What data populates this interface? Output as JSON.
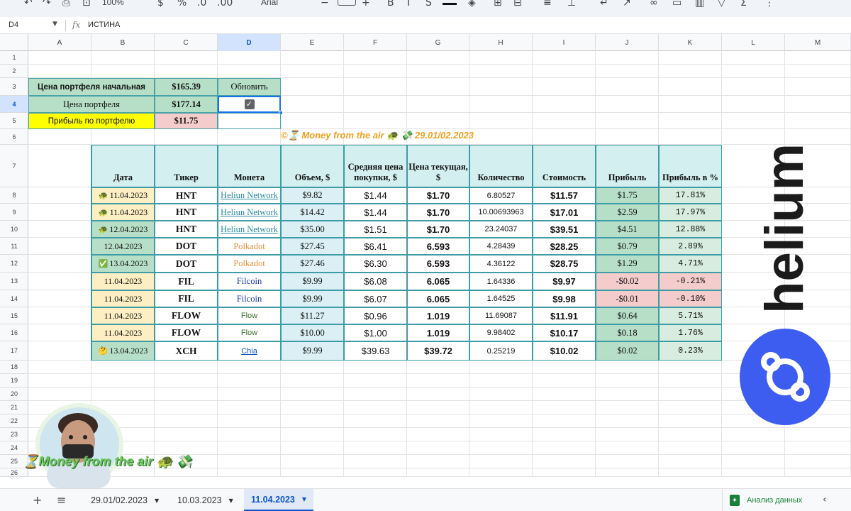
{
  "toolbar": {
    "zoom": "100%",
    "font_name": "Arial",
    "font_size": "10",
    "items": [
      "undo-icon",
      "redo-icon",
      "print-icon",
      "paint-format-icon",
      "currency-icon",
      "percent-icon",
      "decimal-decrease-icon",
      "decimal-increase-icon",
      "font-size-minus-icon",
      "font-size-plus-icon",
      "bold-icon",
      "italic-icon",
      "strikethrough-icon",
      "text-color-icon",
      "fill-color-icon",
      "borders-icon",
      "merge-icon",
      "align-icon",
      "valign-icon",
      "wrap-icon",
      "rotate-icon",
      "link-icon",
      "comment-icon",
      "chart-icon",
      "filter-icon",
      "functions-icon",
      "more-icon"
    ]
  },
  "formula_bar": {
    "cell_ref": "D4",
    "fx_label": "fx",
    "value": "ИСТИНА"
  },
  "columns": [
    "A",
    "B",
    "C",
    "D",
    "E",
    "F",
    "G",
    "H",
    "I",
    "J",
    "K",
    "L",
    "M"
  ],
  "selected_column": "D",
  "rows": [
    "1",
    "2",
    "3",
    "4",
    "5",
    "6",
    "7",
    "8",
    "9",
    "10",
    "11",
    "12",
    "13",
    "14",
    "15",
    "16",
    "17",
    "18",
    "19",
    "20",
    "21",
    "22",
    "23",
    "24",
    "25",
    "26"
  ],
  "selected_row": "4",
  "summary": {
    "start_label": "Цена портфеля начальная",
    "start_value": "$165.39",
    "refresh_label": "Обновить",
    "current_label": "Цена портфеля",
    "current_value": "$177.14",
    "checkbox_checked": true,
    "profit_label": "Прибыль по портфелю",
    "profit_value": "$11.75"
  },
  "banner": "©⏳ Money from the air 🐢 💸  29.01/02.2023",
  "table": {
    "headers": [
      "Дата",
      "Тикер",
      "Монета",
      "Объем, $",
      "Средняя цена покупки, $",
      "Цена текущая, $",
      "Количество",
      "Стоимость",
      "Прибыль",
      "Прибыль в %"
    ],
    "rows": [
      {
        "date": "11.04.2023",
        "icon": "🐢",
        "ticker": "HNT",
        "coin": "Heliun Network",
        "volume": "$9.82",
        "avg_price": "$1.44",
        "cur_price": "$1.70",
        "qty": "6.80527",
        "cost": "$11.57",
        "profit": "$1.75",
        "profit_pct": "17.81%"
      },
      {
        "date": "11.04.2023",
        "icon": "🐢",
        "ticker": "HNT",
        "coin": "Heliun Network",
        "volume": "$14.42",
        "avg_price": "$1.44",
        "cur_price": "$1.70",
        "qty": "10.00693963",
        "cost": "$17.01",
        "profit": "$2.59",
        "profit_pct": "17.97%"
      },
      {
        "date": "12.04.2023",
        "icon": "🐢",
        "ticker": "HNT",
        "coin": "Heliun Network",
        "volume": "$35.00",
        "avg_price": "$1.51",
        "cur_price": "$1.70",
        "qty": "23.24037",
        "cost": "$39.51",
        "profit": "$4.51",
        "profit_pct": "12.88%"
      },
      {
        "date": "12.04.2023",
        "icon": "",
        "ticker": "DOT",
        "coin": "Polkadot",
        "volume": "$27.45",
        "avg_price": "$6.41",
        "cur_price": "6.593",
        "qty": "4.28439",
        "cost": "$28.25",
        "profit": "$0.79",
        "profit_pct": "2.89%"
      },
      {
        "date": "13.04.2023",
        "icon": "✅",
        "ticker": "DOT",
        "coin": "Polkadot",
        "volume": "$27.46",
        "avg_price": "$6.30",
        "cur_price": "6.593",
        "qty": "4.36122",
        "cost": "$28.75",
        "profit": "$1.29",
        "profit_pct": "4.71%"
      },
      {
        "date": "11.04.2023",
        "icon": "",
        "ticker": "FIL",
        "coin": "Filcoin",
        "volume": "$9.99",
        "avg_price": "$6.08",
        "cur_price": "6.065",
        "qty": "1.64336",
        "cost": "$9.97",
        "profit": "-$0.02",
        "profit_pct": "-0.21%"
      },
      {
        "date": "11.04.2023",
        "icon": "",
        "ticker": "FIL",
        "coin": "Filcoin",
        "volume": "$9.99",
        "avg_price": "$6.07",
        "cur_price": "6.065",
        "qty": "1.64525",
        "cost": "$9.98",
        "profit": "-$0.01",
        "profit_pct": "-0.10%"
      },
      {
        "date": "11.04.2023",
        "icon": "",
        "ticker": "FLOW",
        "coin": "Flow",
        "volume": "$11.27",
        "avg_price": "$0.96",
        "cur_price": "1.019",
        "qty": "11.69087",
        "cost": "$11.91",
        "profit": "$0.64",
        "profit_pct": "5.71%"
      },
      {
        "date": "11.04.2023",
        "icon": "",
        "ticker": "FLOW",
        "coin": "Flow",
        "volume": "$10.00",
        "avg_price": "$1.00",
        "cur_price": "1.019",
        "qty": "9.98402",
        "cost": "$10.17",
        "profit": "$0.18",
        "profit_pct": "1.76%"
      },
      {
        "date": "13.04.2023",
        "icon": "🤔",
        "ticker": "XCH",
        "coin": "Chia",
        "volume": "$9.99",
        "avg_price": "$39.63",
        "cur_price": "$39.72",
        "qty": "0.25219",
        "cost": "$10.02",
        "profit": "$0.02",
        "profit_pct": "0.23%"
      }
    ]
  },
  "helium_logo": {
    "word": "helium"
  },
  "overlay": {
    "caption": "⏳Money from the air 🐢 💸"
  },
  "sheets": {
    "tabs": [
      {
        "label": "29.01/02.2023",
        "active": false
      },
      {
        "label": "10.03.2023",
        "active": false
      },
      {
        "label": "11.04.2023",
        "active": true
      }
    ],
    "explore_label": "Анализ данных"
  },
  "colors": {
    "accent": "#1a73e8",
    "header_fill": "#d4efef",
    "green_fill": "#b7dfc8",
    "red_fill": "#f4cccc",
    "cream_fill": "#fdefc3",
    "banner": "#f1a01e",
    "helium_blue": "#3d5df0"
  }
}
